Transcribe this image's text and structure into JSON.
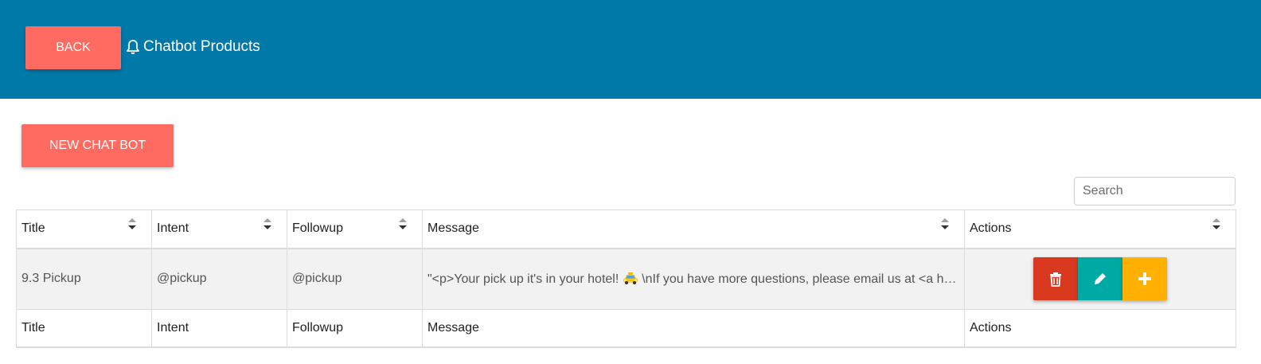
{
  "header": {
    "back_label": "BACK",
    "title": "Chatbot Products",
    "title_icon": "bell-icon",
    "background": "#0079a8"
  },
  "toolbar": {
    "new_label": "NEW CHAT BOT",
    "accent": "#ff6b61"
  },
  "search": {
    "placeholder": "Search",
    "value": ""
  },
  "table": {
    "columns": [
      "Title",
      "Intent",
      "Followup",
      "Message",
      "Actions"
    ],
    "rows": [
      {
        "title": "9.3 Pickup",
        "intent": "@pickup",
        "followup": "@pickup",
        "message_before": "\"<p>Your pick up it's in your hotel! ",
        "message_icon": "taxi-emoji",
        "message_after": " \\nIf you have more questions, please email us at <a href=\"mailto:info@example.com\">info@example.com</a></p>\""
      }
    ],
    "footer": [
      "Title",
      "Intent",
      "Followup",
      "Message",
      "Actions"
    ]
  },
  "actions": {
    "delete": {
      "icon": "trash-icon",
      "color": "#d93a1f"
    },
    "edit": {
      "icon": "pencil-icon",
      "color": "#00aaa4"
    },
    "add": {
      "icon": "plus-icon",
      "color": "#ffb000"
    }
  }
}
